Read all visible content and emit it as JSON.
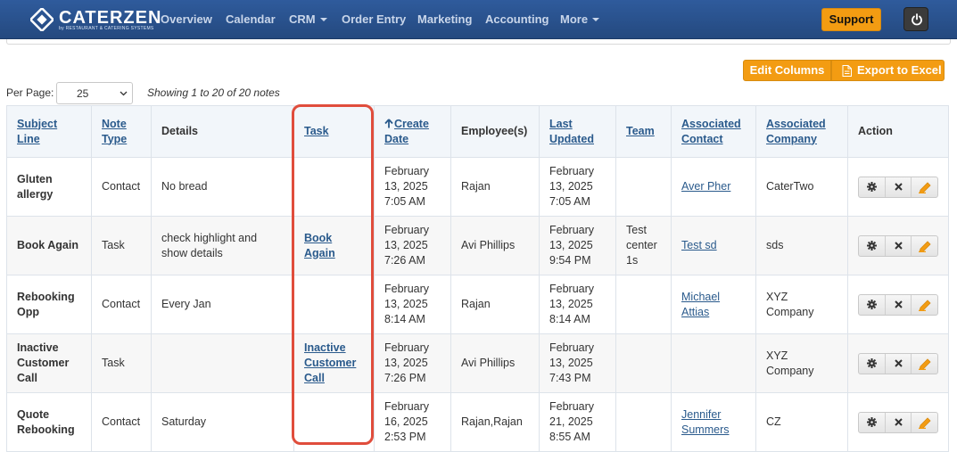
{
  "brand": {
    "name": "CATERZEN",
    "tagline": "by RESTAURANT & CATERING SYSTEMS"
  },
  "nav": {
    "items": [
      "Overview",
      "Calendar",
      "CRM",
      "Order Entry",
      "Marketing",
      "Accounting",
      "More"
    ],
    "support_label": "Support",
    "power_icon": "power-icon"
  },
  "toolbar": {
    "edit_columns_label": "Edit Columns",
    "export_label": "Export to Excel",
    "per_page_label": "Per Page:",
    "per_page_value": "25",
    "showing_text": "Showing 1 to 20 of 20 notes"
  },
  "table": {
    "headers": [
      "Subject Line",
      "Note Type",
      "Details",
      "Task",
      "Create Date",
      "Employee(s)",
      "Last Updated",
      "Team",
      "Associated Contact",
      "Associated Company",
      "Action"
    ],
    "rows": [
      {
        "subject": "Gluten allergy",
        "type": "Contact",
        "details": "No bread",
        "task": "",
        "created": "February 13, 2025 7:05 AM",
        "employees": "Rajan",
        "updated": "February 13, 2025 7:05 AM",
        "team": "",
        "contact": "Aver Pher",
        "company": "CaterTwo"
      },
      {
        "subject": "Book Again",
        "type": "Task",
        "details": "check highlight and show details",
        "task": "Book Again",
        "created": "February 13, 2025 7:26 AM",
        "employees": "Avi Phillips",
        "updated": "February 13, 2025 9:54 PM",
        "team": "Test center 1s",
        "contact": "Test sd",
        "company": "sds"
      },
      {
        "subject": "Rebooking Opp",
        "type": "Contact",
        "details": "Every Jan",
        "task": "",
        "created": "February 13, 2025 8:14 AM",
        "employees": "Rajan",
        "updated": "February 13, 2025 8:14 AM",
        "team": "",
        "contact": "Michael Attias",
        "company": "XYZ Company"
      },
      {
        "subject": "Inactive Customer Call",
        "type": "Task",
        "details": "",
        "task": "Inactive Customer Call",
        "created": "February 13, 2025 7:26 PM",
        "employees": "Avi Phillips",
        "updated": "February 13, 2025 7:43 PM",
        "team": "",
        "contact": "",
        "company": "XYZ Company"
      },
      {
        "subject": "Quote Rebooking",
        "type": "Contact",
        "details": "Saturday",
        "task": "",
        "created": "February 16, 2025 2:53 PM",
        "employees": "Rajan,Rajan",
        "updated": "February 21, 2025 8:55 AM",
        "team": "",
        "contact": "Jennifer Summers",
        "company": "CZ"
      }
    ]
  },
  "colors": {
    "navbar": "#2a528e",
    "accent_orange": "#f39c12",
    "link": "#2a5a8c",
    "highlight": "#e04d3c"
  }
}
